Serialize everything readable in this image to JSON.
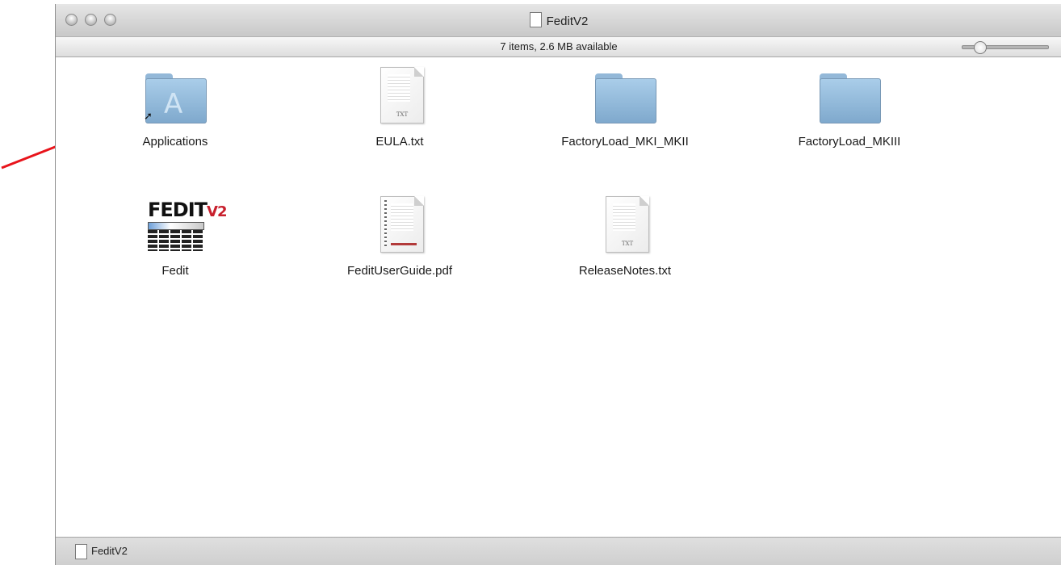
{
  "window": {
    "title": "FeditV2",
    "status": "7 items, 2.6 MB available",
    "path_bar": "FeditV2"
  },
  "items": [
    {
      "label": "Applications",
      "kind": "folder-alias",
      "icon": "applications-folder-icon"
    },
    {
      "label": "EULA.txt",
      "kind": "text-file",
      "icon": "text-file-icon",
      "tag": "TXT"
    },
    {
      "label": "FactoryLoad_MKI_MKII",
      "kind": "folder",
      "icon": "folder-icon"
    },
    {
      "label": "FactoryLoad_MKIII",
      "kind": "folder",
      "icon": "folder-icon"
    },
    {
      "label": "Fedit",
      "kind": "application",
      "icon": "fedit-app-icon",
      "logo_main": "FEDIT",
      "logo_sub": "V2"
    },
    {
      "label": "FeditUserGuide.pdf",
      "kind": "pdf-file",
      "icon": "pdf-file-icon"
    },
    {
      "label": "ReleaseNotes.txt",
      "kind": "text-file",
      "icon": "text-file-icon",
      "tag": "TXT"
    }
  ],
  "annotation": {
    "color": "#e8141b",
    "points_to": "Applications"
  }
}
